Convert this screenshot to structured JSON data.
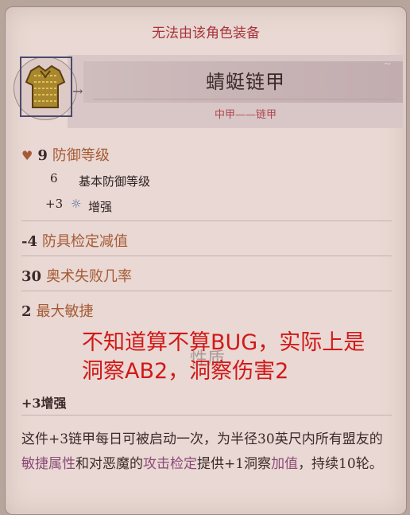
{
  "warning": "无法由该角色装备",
  "item": {
    "name": "蜻蜓链甲",
    "type": "中甲——链甲",
    "icon": "chainmail-armor-icon"
  },
  "stats": {
    "armor_class": {
      "value": "9",
      "label": "防御等级"
    },
    "base_ac": {
      "value": "6",
      "label": "基本防御等级"
    },
    "enhancement": {
      "value": "+3",
      "label": "增强"
    },
    "check_penalty": {
      "value": "-4",
      "label": "防具检定减值"
    },
    "spell_failure": {
      "value": "30",
      "label": "奥术失败几率"
    },
    "max_dex": {
      "value": "2",
      "label": "最大敏捷"
    }
  },
  "overlay": {
    "line1": "不知道算不算BUG，实际上是",
    "line2": "洞察AB2，洞察伤害2"
  },
  "properties": {
    "ghost_title": "性质",
    "title": "+3增强",
    "desc_part1": "这件+3链甲每日可被启动一次，为半径30英尺内所有盟友的",
    "desc_link1": "敏捷属性",
    "desc_part2": "和对恶魔的",
    "desc_link2": "攻击检定",
    "desc_part3": "提供+1洞察",
    "desc_link3": "加值",
    "desc_part4": "，持续10轮。"
  }
}
